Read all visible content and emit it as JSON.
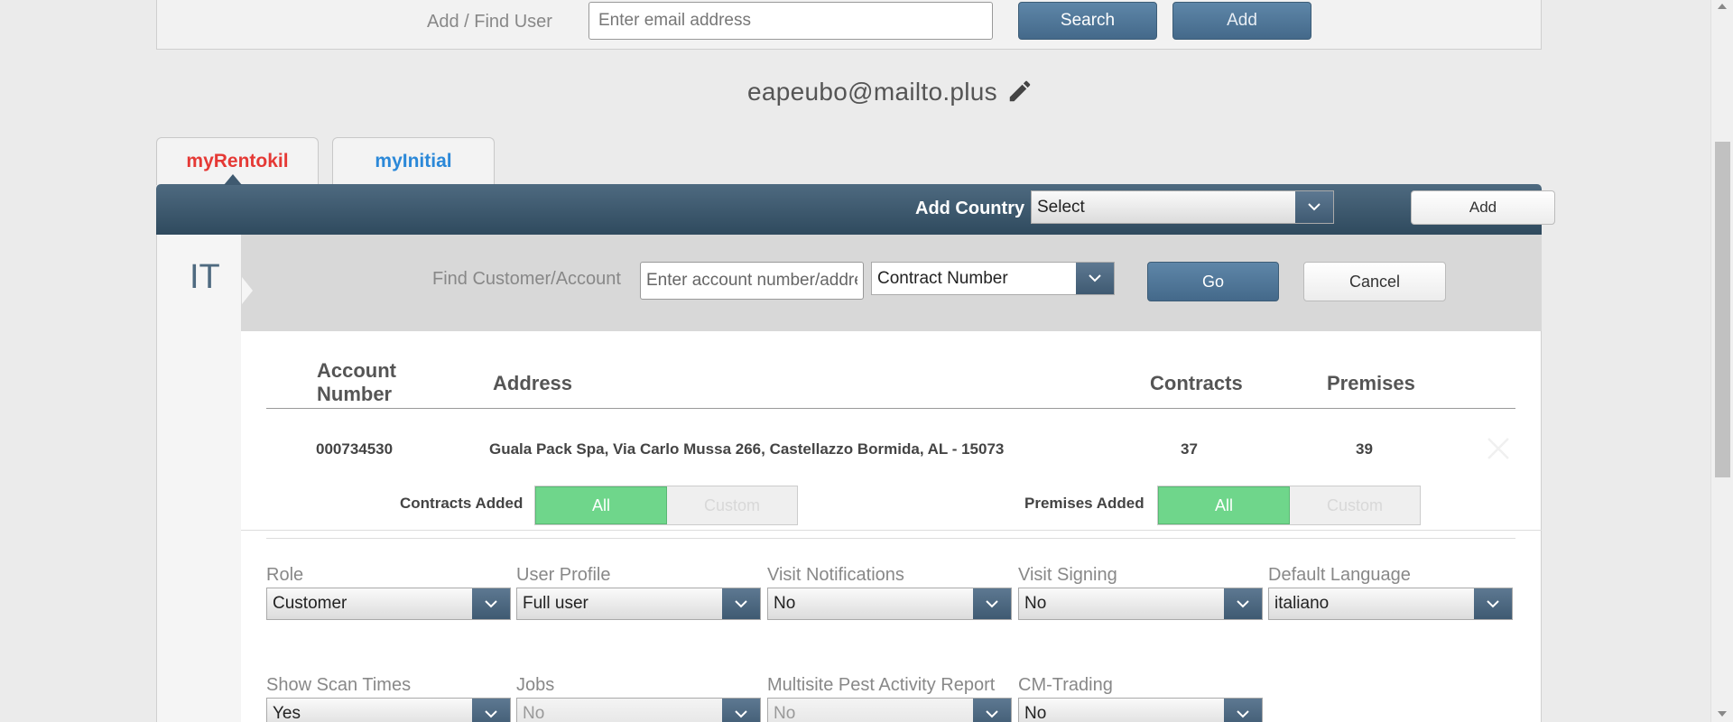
{
  "find_user": {
    "label": "Add / Find User",
    "email_placeholder": "Enter email address",
    "search_label": "Search",
    "add_label": "Add"
  },
  "user": {
    "email": "eapeubo@mailto.plus"
  },
  "tabs": [
    {
      "label": "myRentokil",
      "color": "#e53935",
      "active": true
    },
    {
      "label": "myInitial",
      "color": "#2b88d8",
      "active": false
    }
  ],
  "country_bar": {
    "label": "Add Country",
    "select_value": "Select",
    "add_label": "Add"
  },
  "country": {
    "code": "IT"
  },
  "find_customer": {
    "label": "Find Customer/Account",
    "input_placeholder": "Enter account number/address",
    "type_value": "Contract Number",
    "go_label": "Go",
    "cancel_label": "Cancel"
  },
  "accounts_table": {
    "headers": {
      "account_number": "Account Number",
      "address": "Address",
      "contracts": "Contracts",
      "premises": "Premises"
    },
    "rows": [
      {
        "account_number": "000734530",
        "address": "Guala Pack Spa, Via Carlo Mussa 266, Castellazzo Bormida, AL - 15073",
        "contracts": "37",
        "premises": "39"
      }
    ]
  },
  "contracts_added": {
    "label": "Contracts Added",
    "options": [
      "All",
      "Custom"
    ],
    "selected": "All"
  },
  "premises_added": {
    "label": "Premises Added",
    "options": [
      "All",
      "Custom"
    ],
    "selected": "All"
  },
  "settings_row1": [
    {
      "label": "Role",
      "value": "Customer",
      "disabled": false
    },
    {
      "label": "User Profile",
      "value": "Full user",
      "disabled": false
    },
    {
      "label": "Visit Notifications",
      "value": "No",
      "disabled": false
    },
    {
      "label": "Visit Signing",
      "value": "No",
      "disabled": false
    },
    {
      "label": "Default Language",
      "value": "italiano",
      "disabled": false
    }
  ],
  "settings_row2": [
    {
      "label": "Show Scan Times",
      "value": "Yes",
      "disabled": false
    },
    {
      "label": "Jobs",
      "value": "No",
      "disabled": true
    },
    {
      "label": "Multisite Pest Activity Report",
      "value": "No",
      "disabled": true
    },
    {
      "label": "CM-Trading",
      "value": "No",
      "disabled": false
    }
  ],
  "colors": {
    "header_bar": "#3f5a70",
    "button_blue": "#4f7698",
    "toggle_on": "#6fd68b",
    "tab_rentokil": "#e53935",
    "tab_initial": "#2b88d8"
  }
}
